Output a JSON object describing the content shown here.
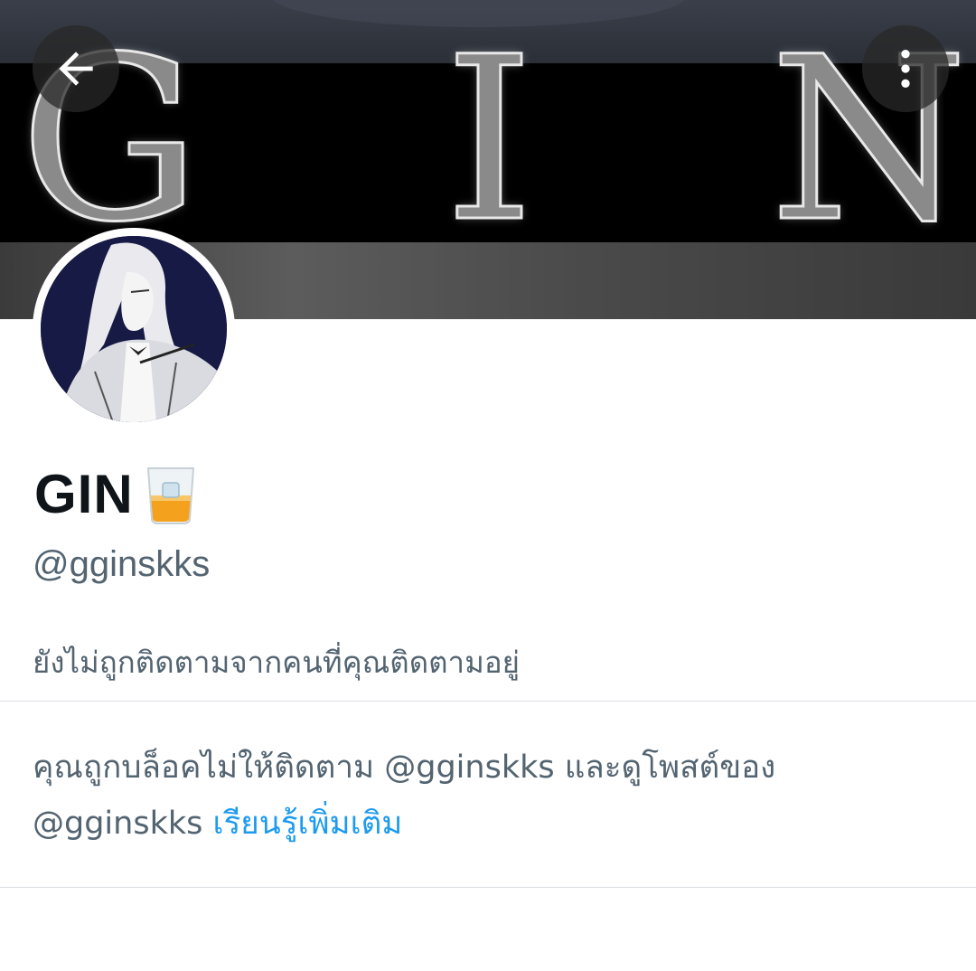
{
  "banner": {
    "letters": [
      "G",
      "I",
      "N"
    ]
  },
  "nav": {
    "back_icon": "arrow-left-icon",
    "more_icon": "more-vertical-icon"
  },
  "profile": {
    "display_name": "GIN",
    "name_emoji": "tumbler-glass-icon",
    "handle": "@gginskks",
    "follow_status": "ยังไม่ถูกติดตามจากคนที่คุณติดตามอยู่"
  },
  "blocked_notice": {
    "text": "คุณถูกบล็อคไม่ให้ติดตาม @gginskks และดูโพสต์ของ @gginskks",
    "link_label": "เรียนรู้เพิ่มเติม"
  },
  "colors": {
    "secondary_text": "#536471",
    "link": "#1d9bf0",
    "primary_text": "#0f1419"
  }
}
